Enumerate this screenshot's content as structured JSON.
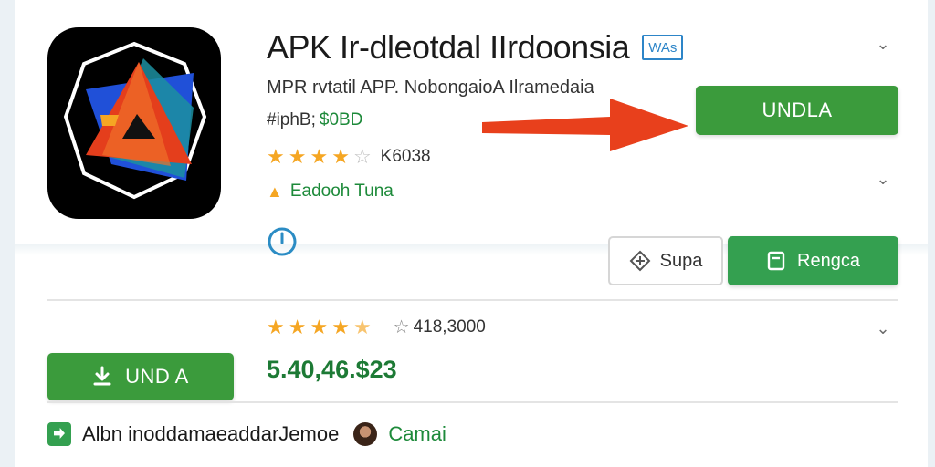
{
  "app": {
    "title": "APK Ir-dleotdal IIrdoonsia",
    "title_badge": "WAs",
    "subtitle": "MPR rvtatil APP. NobongaioA Ilramedaia",
    "meta_prefix": "#iphB;",
    "meta_price": "$0BD",
    "rating_top": {
      "stars": 4,
      "count": "K6038"
    },
    "editor_label": "Eadooh Tuna",
    "icon_name": "triangle-logo-icon"
  },
  "buttons": {
    "install_top": "UNDLA",
    "share": "Supa",
    "save": "Rengca",
    "install_bottom": "UND A"
  },
  "reviews": {
    "stars": 4.5,
    "count": "418,3000",
    "price": "5.40,46.$23"
  },
  "footer": {
    "text": "Albn inoddamaeaddarJemoe",
    "author": "Camai"
  },
  "colors": {
    "primary_green": "#3b9b3c",
    "save_green": "#34a050",
    "star": "#f5a623",
    "badge_blue": "#2d85c8",
    "arrow_red": "#e8401c"
  }
}
